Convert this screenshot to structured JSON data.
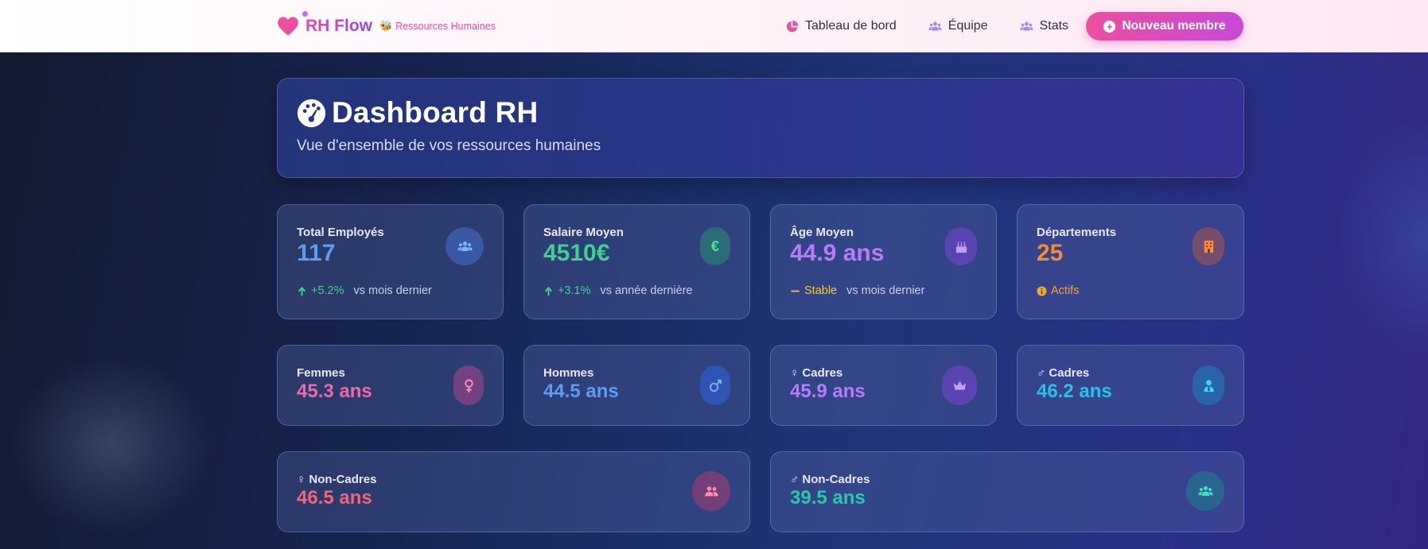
{
  "brand": {
    "name": "RH Flow",
    "tagline": "Ressources Humaines",
    "heart_color": "#ec4f9e"
  },
  "nav": {
    "items": [
      {
        "label": "Tableau de bord",
        "icon": "pie-chart-icon"
      },
      {
        "label": "Équipe",
        "icon": "users-icon"
      },
      {
        "label": "Stats",
        "icon": "users-icon"
      }
    ],
    "cta_label": "Nouveau membre"
  },
  "hero": {
    "title": "Dashboard RH",
    "subtitle": "Vue d'ensemble de vos ressources humaines"
  },
  "stats": [
    {
      "label": "Total Employés",
      "value": "117",
      "change": "+5.2%",
      "reference": "vs mois dernier",
      "icon": "users-icon",
      "color": "#5b9cf6"
    },
    {
      "label": "Salaire Moyen",
      "value": "4510€",
      "change": "+3.1%",
      "reference": "vs année dernière",
      "icon": "euro-icon",
      "color": "#3ed28a"
    },
    {
      "label": "Âge Moyen",
      "value": "44.9 ans",
      "change": "Stable",
      "reference": "vs mois dernier",
      "icon": "birthday-cake-icon",
      "color": "#b67cf6"
    },
    {
      "label": "Départements",
      "value": "25",
      "change": "Actifs",
      "reference": "",
      "icon": "building-icon",
      "color": "#f58a35"
    }
  ],
  "ages": [
    {
      "label": "Femmes",
      "value": "45.3 ans",
      "icon": "venus-icon",
      "color": "#ee6aa7"
    },
    {
      "label": "Hommes",
      "value": "44.5 ans",
      "icon": "mars-icon",
      "color": "#5b9cf6"
    },
    {
      "label": "♀ Cadres",
      "value": "45.9 ans",
      "icon": "crown-icon",
      "color": "#b67cf6"
    },
    {
      "label": "♂ Cadres",
      "value": "46.2 ans",
      "icon": "user-tie-icon",
      "color": "#22c4e8"
    }
  ],
  "non_cadres": [
    {
      "label": "♀ Non-Cadres",
      "value": "46.5 ans",
      "icon": "user-group-icon",
      "color": "#f0647e"
    },
    {
      "label": "♂ Non-Cadres",
      "value": "39.5 ans",
      "icon": "users-icon",
      "color": "#2bc8a8"
    }
  ]
}
